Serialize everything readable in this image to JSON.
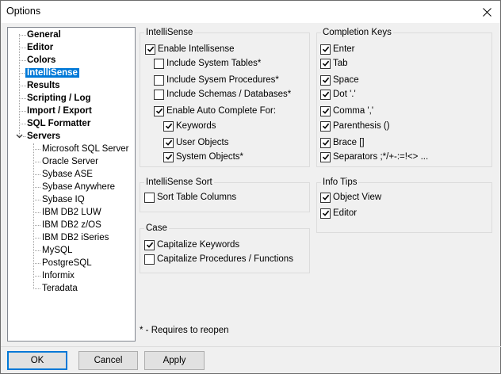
{
  "window": {
    "title": "Options"
  },
  "tree": {
    "items": [
      {
        "label": "General"
      },
      {
        "label": "Editor"
      },
      {
        "label": "Colors"
      },
      {
        "label": "IntelliSense"
      },
      {
        "label": "Results"
      },
      {
        "label": "Scripting / Log"
      },
      {
        "label": "Import / Export"
      },
      {
        "label": "SQL Formatter"
      },
      {
        "label": "Servers"
      }
    ],
    "servers": [
      {
        "label": "Microsoft SQL Server"
      },
      {
        "label": "Oracle Server"
      },
      {
        "label": "Sybase ASE"
      },
      {
        "label": "Sybase Anywhere"
      },
      {
        "label": "Sybase IQ"
      },
      {
        "label": "IBM DB2 LUW"
      },
      {
        "label": "IBM DB2 z/OS"
      },
      {
        "label": "IBM DB2 iSeries"
      },
      {
        "label": "MySQL"
      },
      {
        "label": "PostgreSQL"
      },
      {
        "label": "Informix"
      },
      {
        "label": "Teradata"
      }
    ],
    "selected": "IntelliSense"
  },
  "intellisense": {
    "title": "IntelliSense",
    "options": [
      {
        "label": "Enable Intellisense",
        "checked": true
      },
      {
        "label": "Include System Tables*",
        "checked": false
      },
      {
        "label": "Include Sysem Procedures*",
        "checked": false
      },
      {
        "label": "Include Schemas / Databases*",
        "checked": false
      },
      {
        "label": "Enable Auto Complete For:",
        "checked": true
      },
      {
        "label": "Keywords",
        "checked": true
      },
      {
        "label": "User Objects",
        "checked": true
      },
      {
        "label": "System Objects*",
        "checked": true
      }
    ]
  },
  "completion_keys": {
    "title": "Completion Keys",
    "options": [
      {
        "label": "Enter",
        "checked": true
      },
      {
        "label": "Tab",
        "checked": true
      },
      {
        "label": "Space",
        "checked": true
      },
      {
        "label": "Dot '.'",
        "checked": true
      },
      {
        "label": "Comma ','",
        "checked": true
      },
      {
        "label": "Parenthesis ()",
        "checked": true
      },
      {
        "label": "Brace []",
        "checked": true
      },
      {
        "label": "Separators ;*/+-:=!<> ...",
        "checked": true
      }
    ]
  },
  "sort": {
    "title": "IntelliSense Sort",
    "options": [
      {
        "label": "Sort Table Columns",
        "checked": false
      }
    ]
  },
  "info_tips": {
    "title": "Info Tips",
    "options": [
      {
        "label": "Object View",
        "checked": true
      },
      {
        "label": "Editor",
        "checked": true
      }
    ]
  },
  "case": {
    "title": "Case",
    "options": [
      {
        "label": "Capitalize Keywords",
        "checked": true
      },
      {
        "label": "Capitalize Procedures / Functions",
        "checked": false
      }
    ]
  },
  "footnote": "* - Requires to reopen",
  "buttons": {
    "ok": "OK",
    "cancel": "Cancel",
    "apply": "Apply"
  },
  "colors": {
    "selection": "#0078d7",
    "window_bg": "#f0f0f0"
  }
}
